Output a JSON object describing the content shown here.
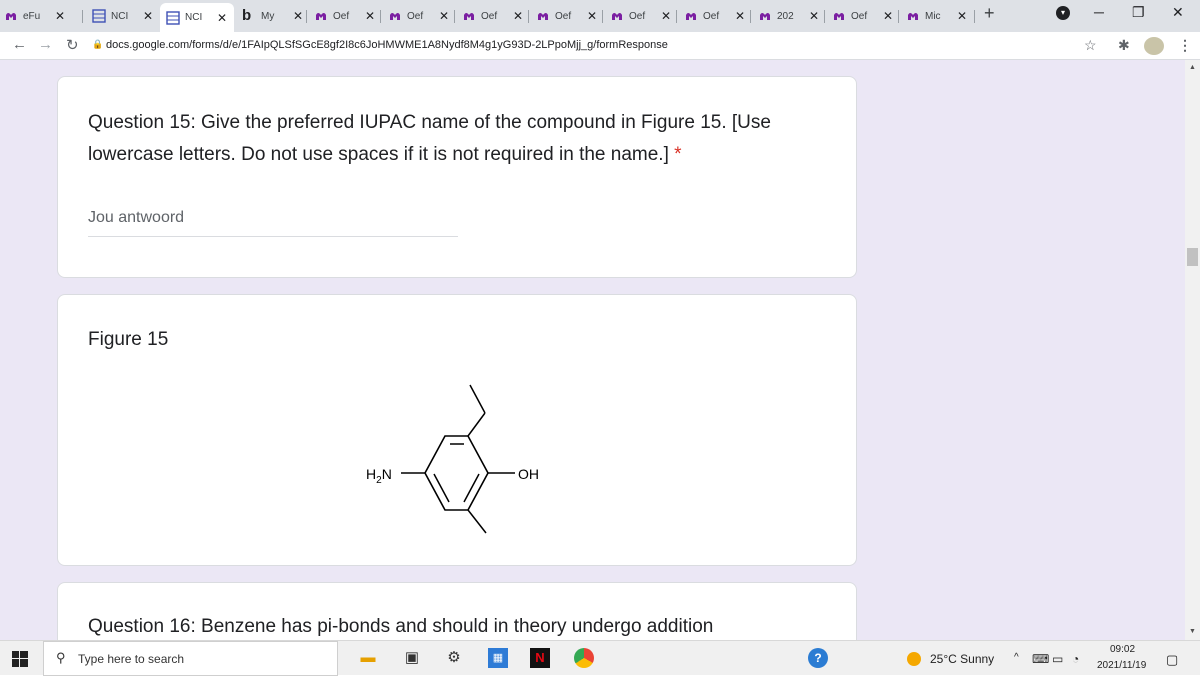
{
  "browser": {
    "tabs": [
      {
        "title": "eFu"
      },
      {
        "title": "NCI"
      },
      {
        "title": "NCI"
      },
      {
        "title": "My"
      },
      {
        "title": "Oef"
      },
      {
        "title": "Oef"
      },
      {
        "title": "Oef"
      },
      {
        "title": "Oef"
      },
      {
        "title": "Oef"
      },
      {
        "title": "Oef"
      },
      {
        "title": "202"
      },
      {
        "title": "Oef"
      },
      {
        "title": "Mic"
      }
    ],
    "url": "docs.google.com/forms/d/e/1FAIpQLSfSGcE8gf2I8c6JoHMWME1A8Nydf8M4g1yG93D-2LPpoMjj_g/formResponse"
  },
  "form": {
    "q15": {
      "text_line1": "Question 15: Give the preferred IUPAC name of the compound in Figure 15. [Use",
      "text_line2": "lowercase letters. Do not use spaces if it is not required in the name.]",
      "required_marker": "*",
      "answer_placeholder": "Jou antwoord"
    },
    "figure": {
      "title": "Figure 15",
      "label_left_main": "H",
      "label_left_sub": "2",
      "label_left_end": "N",
      "label_right": "OH"
    },
    "q16": {
      "text": "Question 16: Benzene has pi-bonds and should in theory undergo addition"
    }
  },
  "taskbar": {
    "search_placeholder": "Type here to search",
    "weather": "25°C  Sunny",
    "time": "09:02",
    "date": "2021/11/19"
  }
}
